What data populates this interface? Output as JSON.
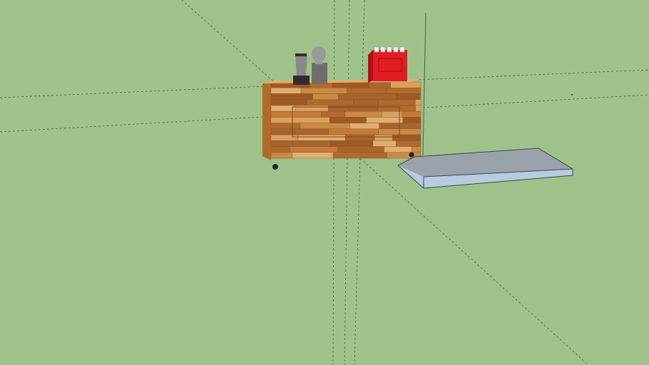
{
  "viewport": {
    "background": "#9ec28a",
    "guide_color": "#4f6147"
  },
  "model": {
    "counter": {
      "wood_colors": [
        "#c98a45",
        "#b06a2c",
        "#d9a060",
        "#9e5a24",
        "#c47b3a",
        "#e0ae70",
        "#a86430"
      ],
      "wheel_color": "#222222"
    },
    "blender": {
      "body_color": "#8a8a8a",
      "base_color": "#2e2e2e"
    },
    "grinder": {
      "body_color": "#6e6e6e",
      "hopper_color": "#9a9a9a"
    },
    "espresso_machine": {
      "body_color": "#e11d23",
      "cup_color": "#f2f2f2"
    },
    "slab": {
      "top_color": "#9aa3ab",
      "side_color": "#b8cbe0",
      "edge_color": "#3d4650"
    }
  }
}
